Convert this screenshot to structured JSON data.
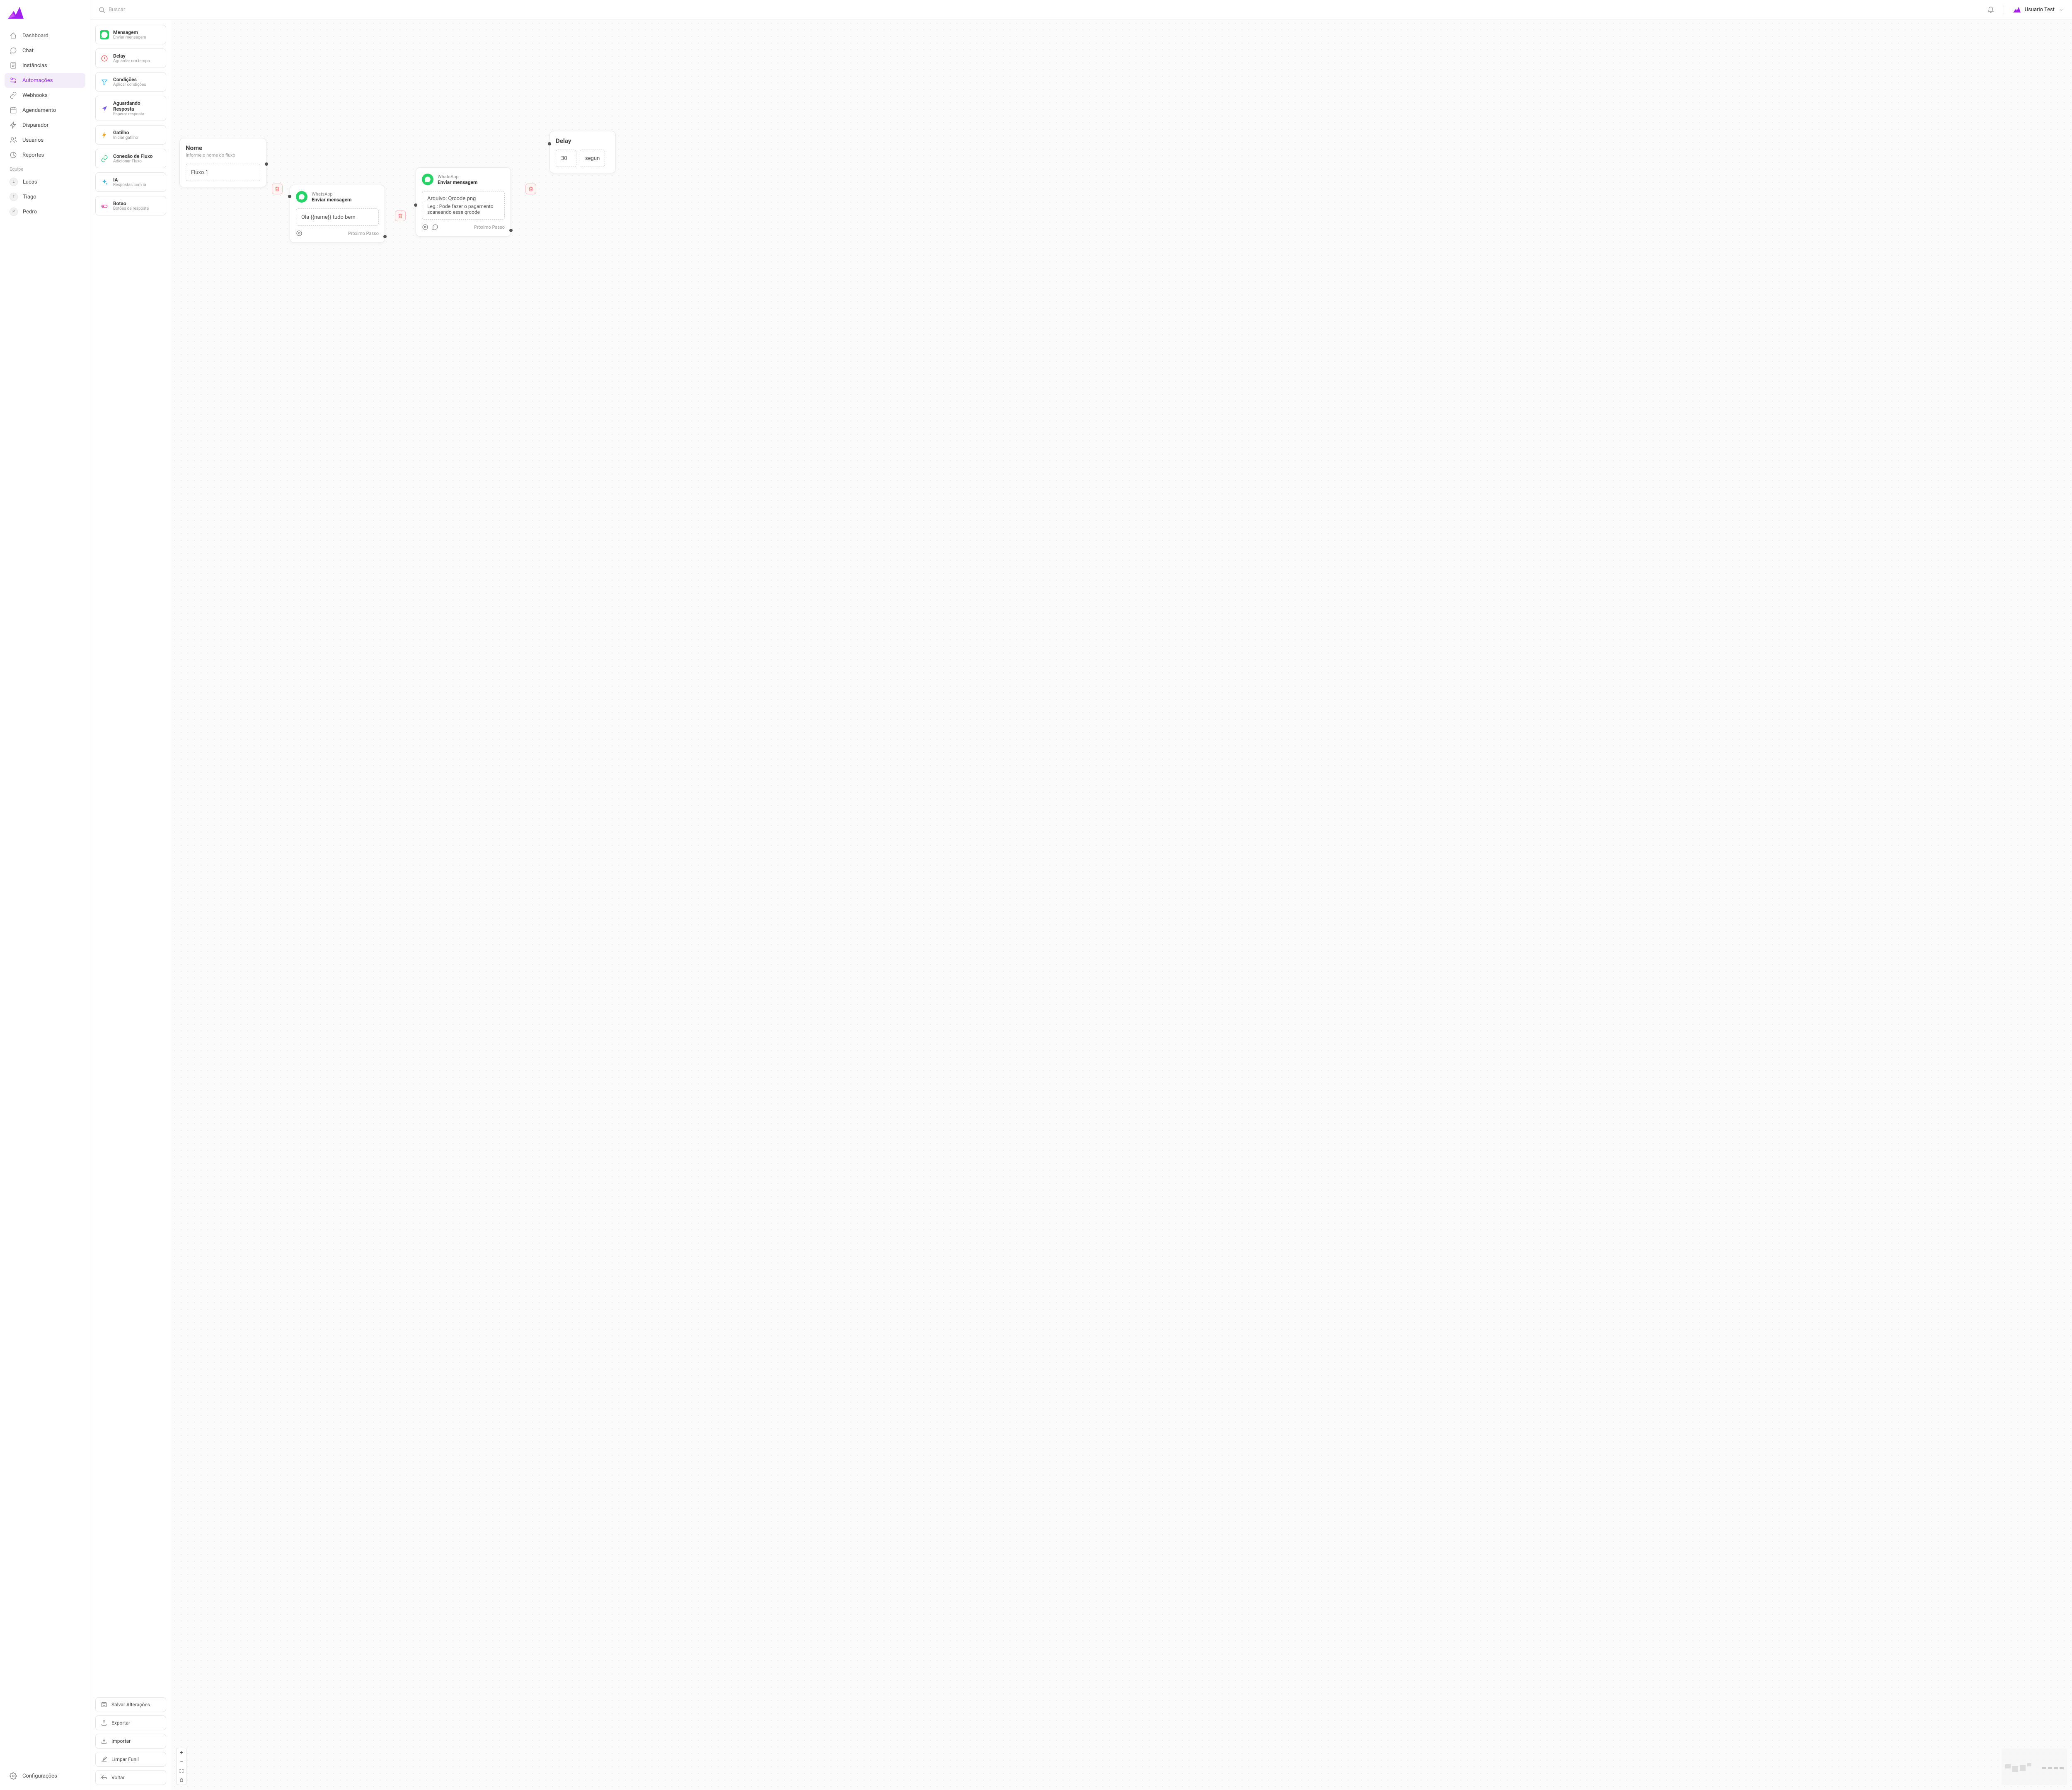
{
  "search": {
    "placeholder": "Buscar"
  },
  "user": {
    "name": "Usuario Test"
  },
  "sidebar": {
    "items": [
      {
        "label": "Dashboard"
      },
      {
        "label": "Chat"
      },
      {
        "label": "Instâncias"
      },
      {
        "label": "Automações"
      },
      {
        "label": "Webhooks"
      },
      {
        "label": "Agendamento"
      },
      {
        "label": "Disparador"
      },
      {
        "label": "Usuarios"
      },
      {
        "label": "Reportes"
      }
    ],
    "team_label": "Equipe",
    "team": [
      {
        "initial": "L",
        "name": "Lucas"
      },
      {
        "initial": "T",
        "name": "Tiago"
      },
      {
        "initial": "P",
        "name": "Pedro"
      }
    ],
    "settings": "Configurações"
  },
  "node_types": [
    {
      "title": "Mensagem",
      "sub": "Enviar mensagem"
    },
    {
      "title": "Delay",
      "sub": "Aguardar um tempo"
    },
    {
      "title": "Condições",
      "sub": "Aplicar condições"
    },
    {
      "title": "Aguardando Resposta",
      "sub": "Esperar resposta"
    },
    {
      "title": "Gatilho",
      "sub": "Iniciar gatilho"
    },
    {
      "title": "Conexão de Fluxo",
      "sub": "Adicionar Fluxo"
    },
    {
      "title": "IA",
      "sub": "Respostas com ia"
    },
    {
      "title": "Botao",
      "sub": "Botões de resposta"
    }
  ],
  "actions": {
    "save": "Salvar Alterações",
    "export": "Exportar",
    "import": "Importar",
    "clear": "Limpar Funil",
    "back": "Voltar"
  },
  "canvas": {
    "start": {
      "title": "Nome",
      "sub": "Informe o nome do fluxo",
      "value": "Fluxo 1"
    },
    "msg1": {
      "label": "WhatsApp",
      "title": "Enviar mensagem",
      "content": "Ola {{name}} tudo bem",
      "next": "Próximo Passo"
    },
    "msg2": {
      "label": "WhatsApp",
      "title": "Enviar mensagem",
      "content_l1": "Arquivo: Qrcode.png",
      "content_l2": "Leg.: Pode fazer o pagamento scaneando esse qrcode",
      "next": "Próximo Passo"
    },
    "delay": {
      "title": "Delay",
      "value": "30",
      "unit": "segun"
    }
  }
}
